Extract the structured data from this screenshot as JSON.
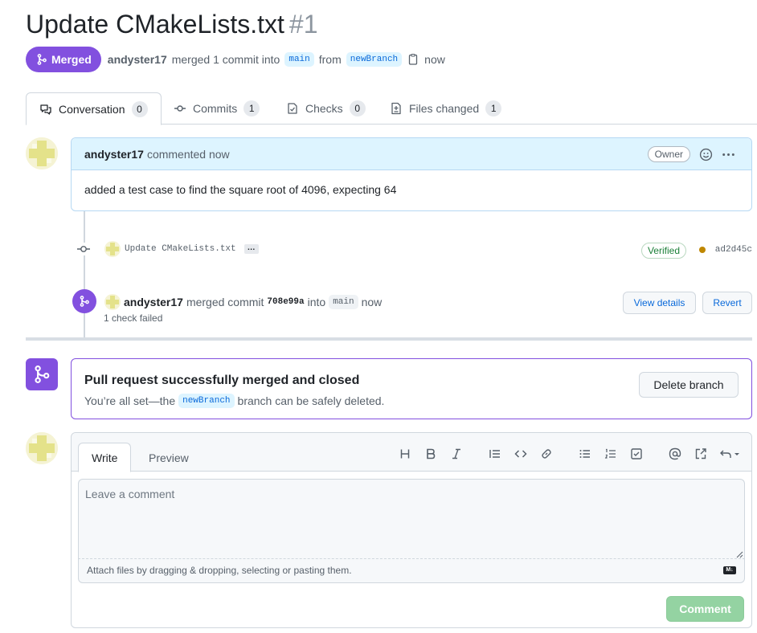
{
  "pr": {
    "title": "Update CMakeLists.txt",
    "number": "#1",
    "state": "Merged",
    "author": "andyster17",
    "merge_text": "merged 1 commit into",
    "base_branch": "main",
    "from_text": "from",
    "head_branch": "newBranch",
    "time": "now"
  },
  "tabs": [
    {
      "label": "Conversation",
      "count": "0"
    },
    {
      "label": "Commits",
      "count": "1"
    },
    {
      "label": "Checks",
      "count": "0"
    },
    {
      "label": "Files changed",
      "count": "1"
    }
  ],
  "comment": {
    "author": "andyster17",
    "action": "commented now",
    "role": "Owner",
    "body": "added a test case to find the square root of 4096, expecting 64"
  },
  "commit": {
    "message": "Update CMakeLists.txt",
    "ellipsis": "…",
    "verified": "Verified",
    "sha": "ad2d45c"
  },
  "merge_event": {
    "author": "andyster17",
    "text": "merged commit",
    "sha": "708e99a",
    "into": "into",
    "branch": "main",
    "time": "now",
    "check_status": "1 check failed",
    "view_details": "View details",
    "revert": "Revert"
  },
  "merged_box": {
    "title": "Pull request successfully merged and closed",
    "sub_before": "You’re all set—the",
    "branch": "newBranch",
    "sub_after": "branch can be safely deleted.",
    "delete_button": "Delete branch"
  },
  "editor": {
    "tab_write": "Write",
    "tab_preview": "Preview",
    "placeholder": "Leave a comment",
    "attach_text": "Attach files by dragging & dropping, selecting or pasting them.",
    "md_label": "M↓",
    "submit": "Comment",
    "toolbar": [
      "heading-icon",
      "bold-icon",
      "italic-icon",
      "quote-icon",
      "code-icon",
      "link-icon",
      "unordered-list-icon",
      "ordered-list-icon",
      "task-list-icon",
      "mention-icon",
      "reference-icon",
      "undo-icon"
    ]
  },
  "colors": {
    "merged": "#8250df",
    "link": "#0969da",
    "verified": "#1a7f37",
    "comment_disabled": "#94d3a2"
  }
}
